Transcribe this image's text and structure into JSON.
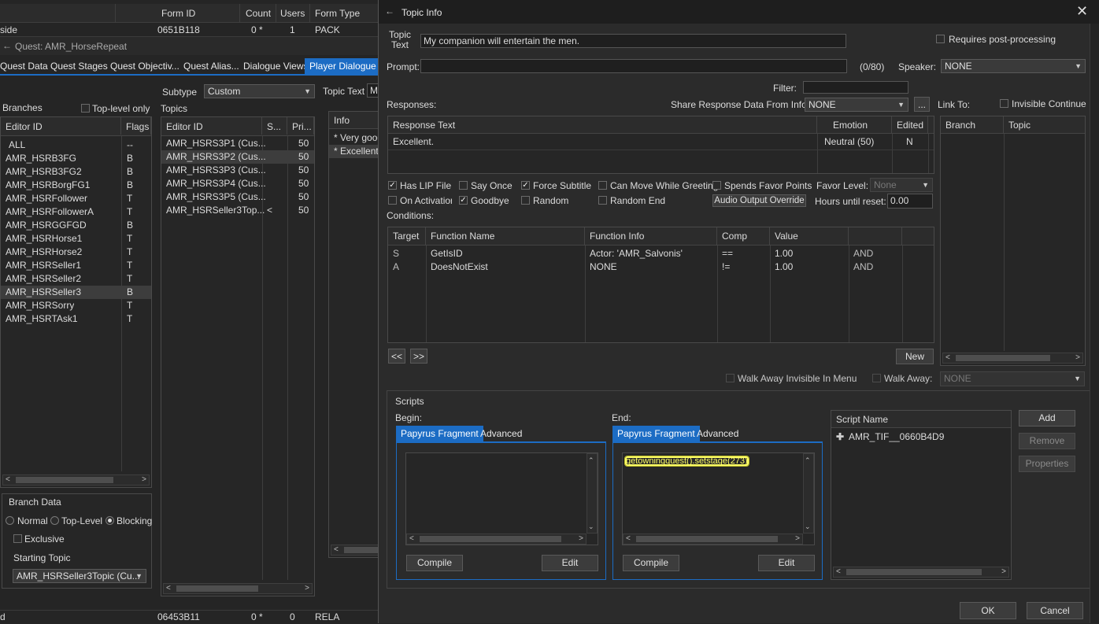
{
  "bg_window": {
    "top_table": {
      "columns": [
        "Form ID",
        "Count",
        "Users",
        "Form Type"
      ],
      "row": {
        "name": "side",
        "form_id": "0651B118",
        "count": "0 *",
        "users": "1",
        "form_type": "PACK"
      },
      "bottom_row": {
        "name": "d",
        "form_id": "06453B11",
        "count": "0 *",
        "users": "0",
        "form_type": "RELA"
      }
    },
    "quest_title": "Quest: AMR_HorseRepeat",
    "tabs": [
      "Quest Data",
      "Quest Stages",
      "Quest Objectiv...",
      "Quest Alias...",
      "Dialogue Views",
      "Player Dialogue"
    ],
    "branches_label": "Branches",
    "top_level_only": "Top-level only",
    "subtype_label": "Subtype",
    "subtype_value": "Custom",
    "topic_text_label": "Topic Text",
    "topic_text_value": "M",
    "topics_label": "Topics",
    "branches": {
      "columns": [
        "Editor ID",
        "Flags"
      ],
      "rows": [
        {
          "id": "ALL",
          "flag": "--"
        },
        {
          "id": "AMR_HSRB3FG",
          "flag": "B"
        },
        {
          "id": "AMR_HSRB3FG2",
          "flag": "B"
        },
        {
          "id": "AMR_HSRBorgFG1",
          "flag": "B"
        },
        {
          "id": "AMR_HSRFollower",
          "flag": "T"
        },
        {
          "id": "AMR_HSRFollowerA",
          "flag": "T"
        },
        {
          "id": "AMR_HSRGGFGD",
          "flag": "B"
        },
        {
          "id": "AMR_HSRHorse1",
          "flag": "T"
        },
        {
          "id": "AMR_HSRHorse2",
          "flag": "T"
        },
        {
          "id": "AMR_HSRSeller1",
          "flag": "T"
        },
        {
          "id": "AMR_HSRSeller2",
          "flag": "T"
        },
        {
          "id": "AMR_HSRSeller3",
          "flag": "B"
        },
        {
          "id": "AMR_HSRSorry",
          "flag": "T"
        },
        {
          "id": "AMR_HSRTAsk1",
          "flag": "T"
        }
      ]
    },
    "topics": {
      "columns": [
        "Editor ID",
        "S...",
        "Pri..."
      ],
      "rows": [
        {
          "id": "AMR_HSRS3P1 (Cus...",
          "s": "",
          "p": "50"
        },
        {
          "id": "AMR_HSRS3P2 (Cus...",
          "s": "",
          "p": "50"
        },
        {
          "id": "AMR_HSRS3P3 (Cus...",
          "s": "",
          "p": "50"
        },
        {
          "id": "AMR_HSRS3P4 (Cus...",
          "s": "",
          "p": "50"
        },
        {
          "id": "AMR_HSRS3P5 (Cus...",
          "s": "",
          "p": "50"
        },
        {
          "id": "AMR_HSRSeller3Top...",
          "s": "<",
          "p": "50"
        }
      ]
    },
    "info": {
      "column": "Info",
      "rows": [
        "* Very good",
        "* Excellent."
      ]
    },
    "branch_data": {
      "title": "Branch Data",
      "normal": "Normal",
      "top_level": "Top-Level",
      "blocking": "Blocking",
      "exclusive": "Exclusive",
      "starting_topic_label": "Starting Topic",
      "starting_topic_value": "AMR_HSRSeller3Topic (Cu..."
    }
  },
  "dialog": {
    "title": "Topic Info",
    "topic_text_label": "Topic\nText",
    "topic_text_value": "My companion will entertain the men.",
    "requires_post_processing": "Requires post-processing",
    "prompt_label": "Prompt:",
    "prompt_count": "(0/80)",
    "speaker_label": "Speaker:",
    "speaker_value": "NONE",
    "filter_label": "Filter:",
    "responses_label": "Responses:",
    "share_response_label": "Share Response Data From Info:",
    "share_response_value": "NONE",
    "ellipsis_button": "...",
    "link_to_label": "Link To:",
    "invisible_continue": "Invisible Continue",
    "responses_table": {
      "columns": [
        "Response Text",
        "Emotion",
        "Edited"
      ],
      "rows": [
        {
          "text": "Excellent.",
          "emotion": "Neutral (50)",
          "edited": "N"
        }
      ]
    },
    "link_table": {
      "columns": [
        "Branch",
        "Topic"
      ]
    },
    "flags": {
      "has_lip_file": "Has LIP File",
      "say_once": "Say Once",
      "force_subtitle": "Force Subtitle",
      "can_move_while_greeting": "Can Move While Greeting",
      "spends_favor_points": "Spends Favor Points",
      "favor_level_label": "Favor Level:",
      "favor_level_value": "None",
      "on_activation": "On Activation",
      "goodbye": "Goodbye",
      "random": "Random",
      "random_end": "Random End",
      "audio_output_override": "Audio Output Override",
      "hours_until_reset_label": "Hours until reset:",
      "hours_until_reset_value": "0.00"
    },
    "conditions_label": "Conditions:",
    "conditions_table": {
      "columns": [
        "Target",
        "Function Name",
        "Function Info",
        "Comp",
        "Value"
      ],
      "rows": [
        {
          "target": "S",
          "fn": "GetIsID",
          "info": "Actor: 'AMR_Salvonis'",
          "comp": "==",
          "value": "1.00",
          "op": "AND"
        },
        {
          "target": "A",
          "fn": "DoesNotExist",
          "info": "NONE",
          "comp": "!=",
          "value": "1.00",
          "op": "AND"
        }
      ]
    },
    "prev_button": "<<",
    "next_button": ">>",
    "new_button": "New",
    "walk_away_invisible": "Walk Away Invisible In Menu",
    "walk_away_label": "Walk Away:",
    "walk_away_value": "NONE",
    "scripts": {
      "title": "Scripts",
      "begin_label": "Begin:",
      "end_label": "End:",
      "papyrus_tab": "Papyrus Fragment",
      "advanced_tab": "Advanced",
      "begin_code": "",
      "end_code": "getowningquest().setstage(273)",
      "compile_button": "Compile",
      "edit_button": "Edit",
      "script_name_column": "Script Name",
      "script_name": "AMR_TIF__0660B4D9",
      "add_button": "Add",
      "remove_button": "Remove",
      "properties_button": "Properties"
    },
    "ok_button": "OK",
    "cancel_button": "Cancel"
  },
  "colors": {
    "accent": "#1c6cc4",
    "highlight": "#ffff66"
  }
}
